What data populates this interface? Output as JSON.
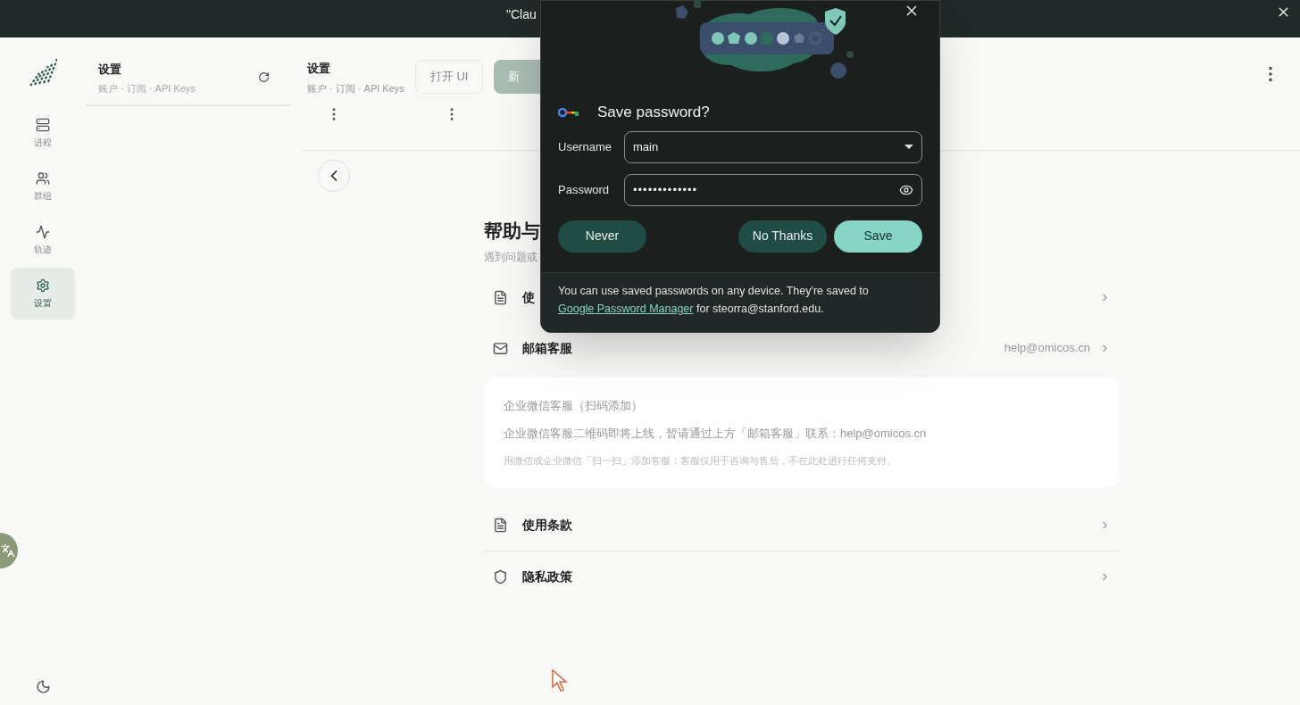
{
  "top_bar": {
    "title": "\"Clau"
  },
  "sidebar": {
    "items": [
      {
        "label": "进程",
        "selected": false
      },
      {
        "label": "群组",
        "selected": false
      },
      {
        "label": "轨迹",
        "selected": false
      },
      {
        "label": "设置",
        "selected": true
      }
    ]
  },
  "list_panel": {
    "title": "设置",
    "subtitle": "账户 · 订阅 · API Keys"
  },
  "main_header": {
    "title": "设置",
    "subtitle": "账户 · 订阅 · API Keys",
    "buttons": [
      {
        "label": "打开 UI",
        "kind": "outline"
      },
      {
        "label": "新",
        "kind": "filled"
      }
    ]
  },
  "help": {
    "title": "帮助与",
    "subtitle": "遇到问题或",
    "rows": [
      {
        "kind": "row",
        "label": "使"
      },
      {
        "kind": "row",
        "label": "邮箱客服",
        "value": "help@omicos.cn"
      },
      {
        "kind": "card",
        "heading": "企业微信客服（扫码添加）",
        "text": "企业微信客服二维码即将上线，暂请通过上方「邮箱客服」联系：help@omicos.cn",
        "note": "用微信或企业微信「扫一扫」添加客服；客服仅用于咨询与售后，不在此处进行任何支付。"
      },
      {
        "kind": "row",
        "label": "使用条款"
      },
      {
        "kind": "row",
        "label": "隐私政策"
      }
    ]
  },
  "dialog": {
    "title": "Save password?",
    "username_label": "Username",
    "username": "main",
    "password_label": "Password",
    "password": "•••••••••••••",
    "buttons": [
      {
        "label": "Never",
        "kind": "secondary"
      },
      {
        "label": "No Thanks",
        "kind": "secondary"
      },
      {
        "label": "Save",
        "kind": "primary"
      }
    ],
    "footer_before": "You can use saved passwords on any device. They're saved to",
    "footer_link": "Google Password Manager",
    "footer_after": "for steorra@stanford.edu."
  }
}
